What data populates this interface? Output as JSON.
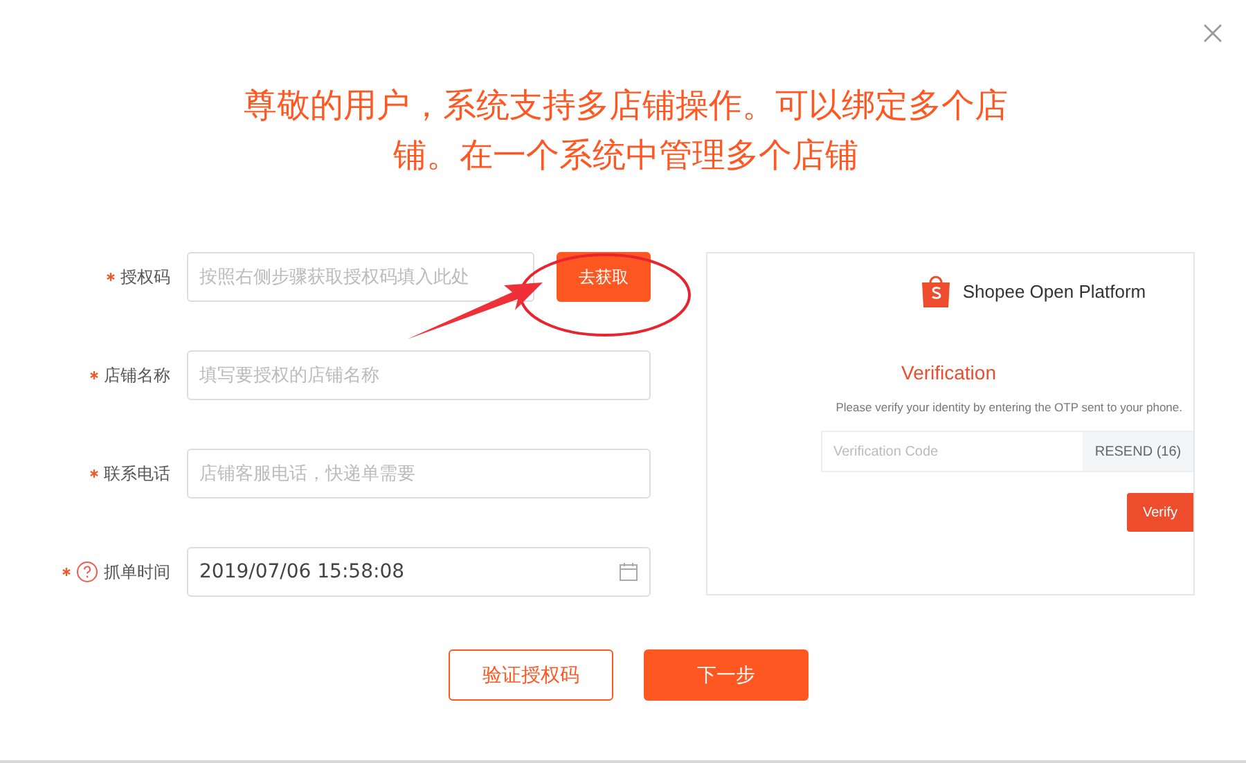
{
  "title": "尊敬的用户，系统支持多店铺操作。可以绑定多个店铺。在一个系统中管理多个店铺",
  "fields": [
    {
      "kind": "text",
      "label": "授权码",
      "required": true,
      "help": false,
      "placeholder": "按照右侧步骤获取授权码填入此处",
      "action": "去获取"
    },
    {
      "kind": "text",
      "label": "店铺名称",
      "required": true,
      "help": false,
      "placeholder": "填写要授权的店铺名称"
    },
    {
      "kind": "text",
      "label": "联系电话",
      "required": true,
      "help": false,
      "placeholder": "店铺客服电话，快递单需要"
    },
    {
      "kind": "date",
      "label": "抓单时间",
      "required": true,
      "help": true,
      "value": "2019/07/06 15:58:08"
    }
  ],
  "guide": {
    "brand": "Shopee Open Platform",
    "heading": "Verification",
    "description": "Please verify your identity by entering the OTP sent to your phone.",
    "code_placeholder": "Verification Code",
    "resend": "RESEND (16)",
    "verify": "Verify"
  },
  "buttons": [
    {
      "kind": "outline",
      "label": "验证授权码"
    },
    {
      "kind": "primary",
      "label": "下一步"
    }
  ]
}
